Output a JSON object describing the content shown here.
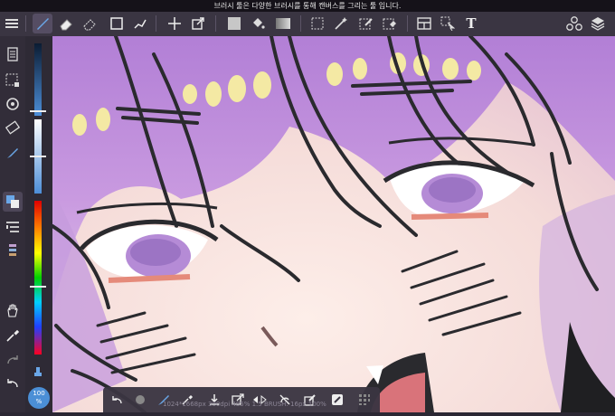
{
  "status": {
    "hint": "브러시 툴은 다양한 브러시를 통해 캔버스를 그리는 툴 입니다."
  },
  "toolbar": {
    "text_tool_glyph": "T"
  },
  "canvas_info": {
    "text": "1024*1668px 300dpi 485% 1.5 BRUSH: 16px 100%"
  },
  "zoom": {
    "value": "100",
    "unit": "%"
  },
  "colors": {
    "accent": "#4b8fd6",
    "toolbar_bg": "#3a3542",
    "sidebar_bg": "#322d39"
  },
  "icons": [
    "menu-icon",
    "brush-icon",
    "eraser-icon",
    "blur-icon",
    "rectangle-icon",
    "line-icon",
    "move-icon",
    "transform-icon",
    "fill-color-icon",
    "bucket-icon",
    "gradient-icon",
    "select-rect-icon",
    "magic-wand-icon",
    "select-pen-icon",
    "select-eraser-icon",
    "canvas-icon",
    "select-move-icon",
    "text-icon",
    "materials-icon",
    "layers-icon"
  ]
}
